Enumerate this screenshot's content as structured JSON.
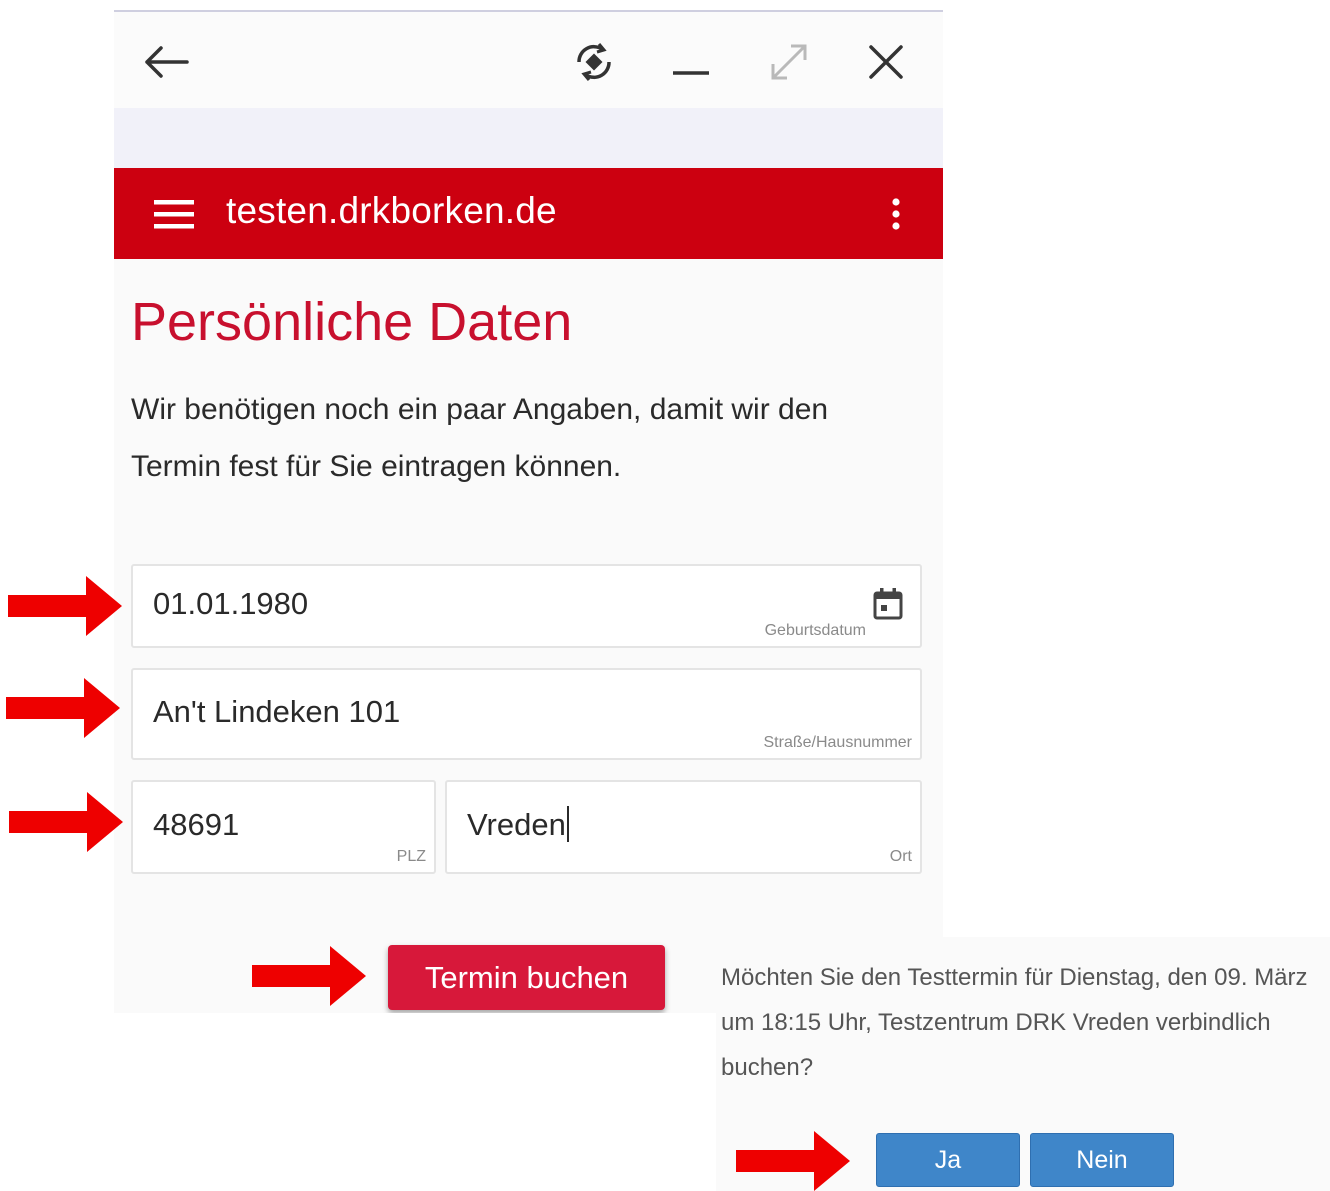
{
  "browser": {
    "back_icon": "arrow-left-icon",
    "rotate_icon": "screen-rotate-icon",
    "minimize_icon": "minimize-icon",
    "expand_icon": "expand-icon",
    "close_icon": "close-icon"
  },
  "appbar": {
    "url": "testen.drkborken.de",
    "color": "#cc0010",
    "menu_icon": "hamburger-menu-icon",
    "more_icon": "more-vertical-icon"
  },
  "page": {
    "title": "Persönliche Daten",
    "intro": "Wir benötigen noch ein paar Angaben, damit wir den Termin fest für Sie eintragen können.",
    "title_color": "#c8102e"
  },
  "form": {
    "birthdate": {
      "value": "01.01.1980",
      "label": "Geburtsdatum",
      "icon": "calendar-icon"
    },
    "street": {
      "value": "An't Lindeken 101",
      "label": "Straße/Hausnummer"
    },
    "zip": {
      "value": "48691",
      "label": "PLZ"
    },
    "city": {
      "value": "Vreden",
      "label": "Ort"
    },
    "submit_label": "Termin buchen",
    "submit_color": "#d7183a"
  },
  "dialog": {
    "message": "Möchten Sie den Testtermin für Dienstag, den 09. März um 18:15 Uhr, Testzentrum DRK Vreden verbindlich buchen?",
    "yes_label": "Ja",
    "no_label": "Nein",
    "button_color": "#3f86c9"
  },
  "annotations": {
    "arrow_color": "#ee0000",
    "arrow_icon": "arrow-right-icon"
  }
}
